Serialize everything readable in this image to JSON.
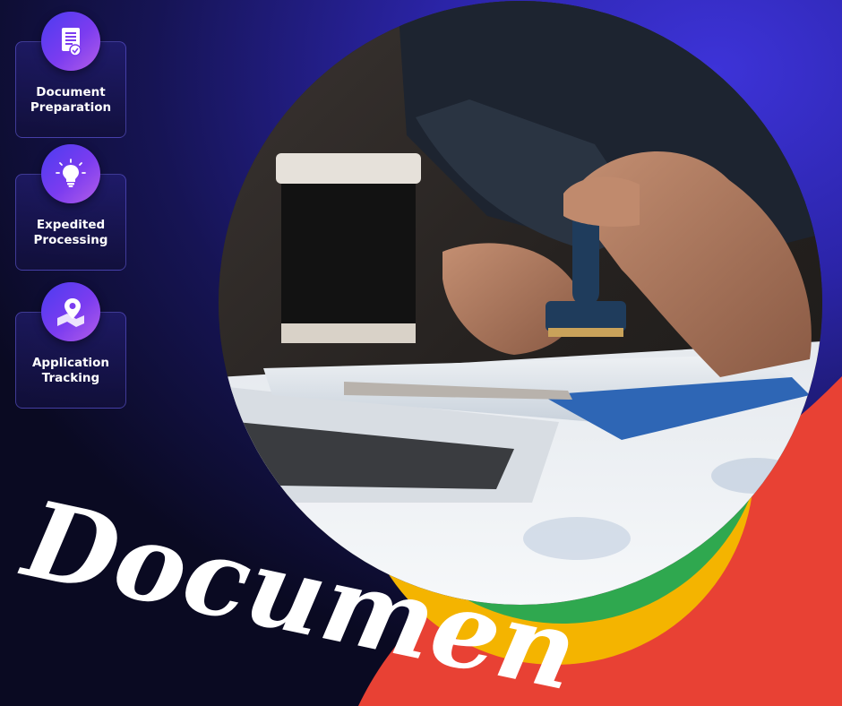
{
  "features": [
    {
      "label": "Document\nPreparation",
      "icon": "document-check-icon"
    },
    {
      "label": "Expedited\nProcessing",
      "icon": "lightbulb-icon"
    },
    {
      "label": "Application\nTracking",
      "icon": "map-pin-icon"
    }
  ],
  "headline": "Document",
  "colors": {
    "blue": "#2e27c9",
    "red": "#e84134",
    "yellow": "#f4b400",
    "green": "#2fa84f",
    "icon_gradient_start": "#4b3cf0",
    "icon_gradient_end": "#b35ee8"
  }
}
